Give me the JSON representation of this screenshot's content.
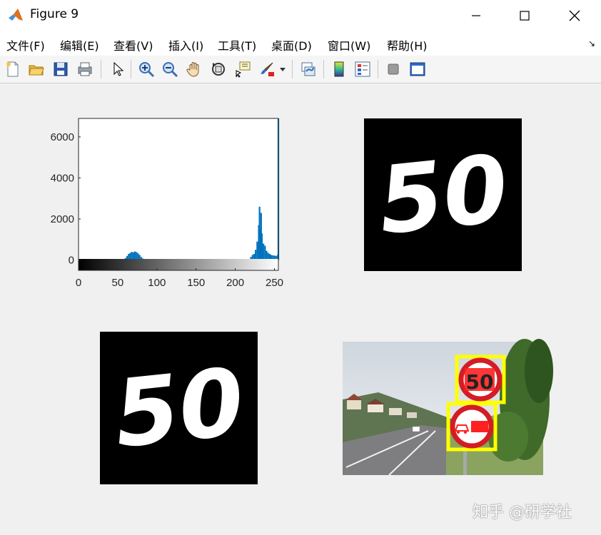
{
  "window": {
    "title": "Figure 9",
    "controls": [
      "minimize",
      "maximize",
      "close"
    ]
  },
  "menu": {
    "items": [
      "文件(F)",
      "编辑(E)",
      "查看(V)",
      "插入(I)",
      "工具(T)",
      "桌面(D)",
      "窗口(W)",
      "帮助(H)"
    ]
  },
  "toolbar": {
    "buttons": [
      "new-figure",
      "open-file",
      "save-figure",
      "print-figure",
      "edit-plot",
      "zoom-in",
      "zoom-out",
      "pan",
      "rotate-3d",
      "data-cursor",
      "brush",
      "link-plot",
      "colorbar",
      "legend",
      "hide-plot-tools",
      "show-plot-tools"
    ]
  },
  "figure": {
    "histogram": {
      "chart_data": {
        "type": "bar",
        "title": "",
        "xlabel": "",
        "ylabel": "",
        "xlim": [
          0,
          255
        ],
        "ylim": [
          -500,
          6900
        ],
        "xticks": [
          "0",
          "50",
          "100",
          "150",
          "200",
          "250"
        ],
        "yticks": [
          "0",
          "2000",
          "4000",
          "6000"
        ],
        "bar_color": "#0072bd",
        "series": [
          {
            "x": [
              60,
              62,
              64,
              66,
              68,
              70,
              72,
              74,
              76,
              78,
              80,
              82,
              220,
              222,
              224,
              226,
              228,
              230,
              231,
              232,
              233,
              234,
              236,
              238,
              240,
              242,
              244,
              246,
              248,
              250,
              252,
              254,
              255
            ],
            "values": [
              100,
              200,
              300,
              350,
              400,
              380,
              420,
              390,
              330,
              250,
              150,
              80,
              150,
              250,
              300,
              500,
              900,
              1700,
              2600,
              1500,
              2300,
              1300,
              800,
              700,
              450,
              350,
              300,
              250,
              230,
              220,
              200,
              250,
              6900
            ]
          }
        ]
      }
    },
    "panels": [
      {
        "name": "binary-sign-top-right",
        "text": "50"
      },
      {
        "name": "binary-sign-bottom-left",
        "text": "50"
      },
      {
        "name": "detection-photo",
        "sign_text": "50"
      }
    ]
  },
  "watermark": "知乎 @研学社"
}
